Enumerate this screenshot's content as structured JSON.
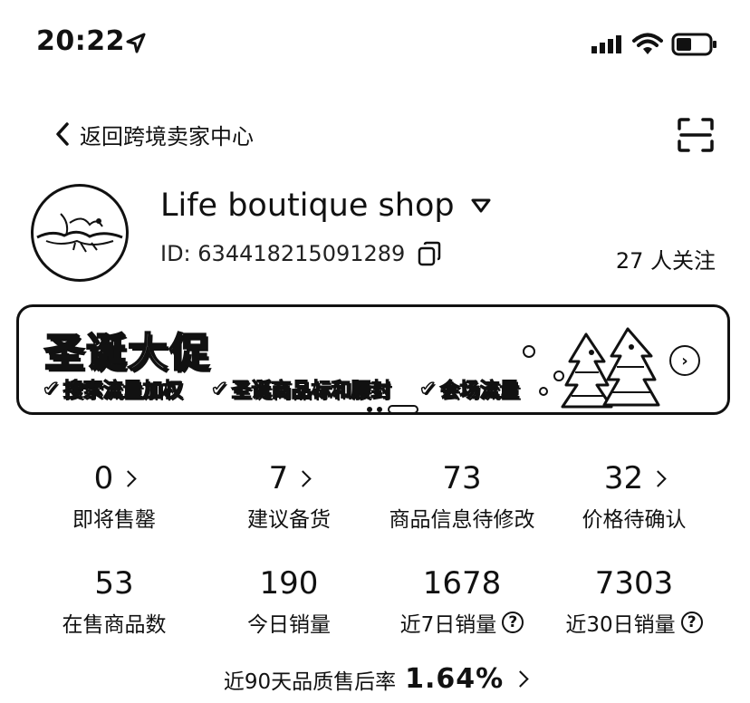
{
  "status_bar": {
    "time": "20:22"
  },
  "nav": {
    "back_label": "返回跨境卖家中心"
  },
  "shop": {
    "name": "Life boutique shop",
    "id_text": "ID: 634418215091289",
    "followers_text": "27 人关注"
  },
  "banner": {
    "title": "圣诞大促",
    "perks": [
      "搜索流量加权",
      "圣诞商品标和腰封",
      "会场流量"
    ]
  },
  "stats_row1": [
    {
      "value": "0",
      "label": "即将售罄"
    },
    {
      "value": "7",
      "label": "建议备货"
    },
    {
      "value": "73",
      "label": "商品信息待修改"
    },
    {
      "value": "32",
      "label": "价格待确认"
    }
  ],
  "stats_row2": [
    {
      "value": "53",
      "label": "在售商品数"
    },
    {
      "value": "190",
      "label": "今日销量"
    },
    {
      "value": "1678",
      "label": "近7日销量"
    },
    {
      "value": "7303",
      "label": "近30日销量"
    }
  ],
  "after_sales": {
    "label": "近90天品质售后率",
    "rate": "1.64%"
  },
  "icons": {
    "location": "location-arrow-icon",
    "signal": "cellular-signal-icon",
    "wifi": "wifi-icon",
    "battery": "battery-icon",
    "back": "chevron-left-icon",
    "scan": "scan-icon",
    "dropdown": "caret-down-icon",
    "copy": "copy-icon",
    "help": "question-circle-icon",
    "chevron": "chevron-right-icon"
  }
}
